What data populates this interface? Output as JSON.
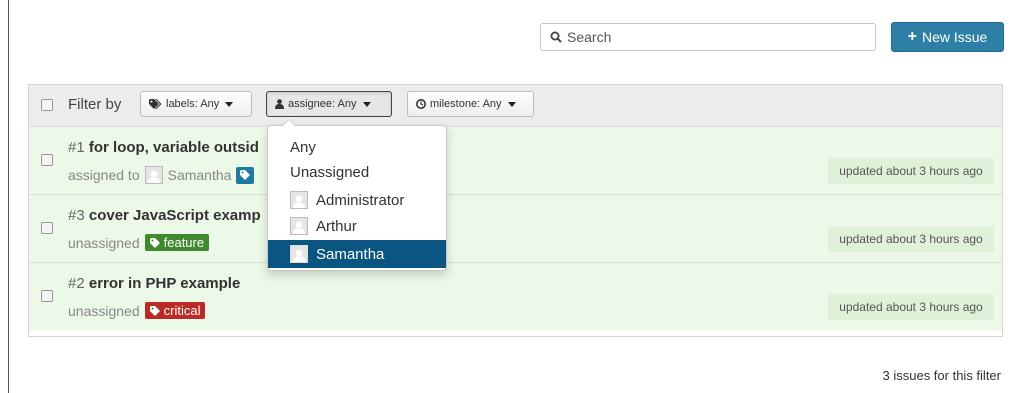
{
  "header": {
    "search_placeholder": "Search",
    "new_issue_label": "New Issue"
  },
  "filter": {
    "label": "Filter by",
    "labels_button": "labels: Any",
    "assignee_button": "assignee: Any",
    "milestone_button": "milestone: Any"
  },
  "issues": [
    {
      "number": "#1",
      "title": "for loop, variable outsid",
      "assignment": "assigned to",
      "assignee": "Samantha",
      "label": "",
      "label_color": "#1f7aa0",
      "updated": "updated about 3 hours ago"
    },
    {
      "number": "#3",
      "title": "cover JavaScript examp",
      "assignment": "unassigned",
      "label": "feature",
      "label_color": "#3f8a2e",
      "updated": "updated about 3 hours ago"
    },
    {
      "number": "#2",
      "title": "error in PHP example",
      "assignment": "unassigned",
      "label": "critical",
      "label_color": "#b92b27",
      "updated": "updated about 3 hours ago"
    }
  ],
  "assignee_dropdown": {
    "options": [
      "Any",
      "Unassigned",
      "Administrator",
      "Arthur",
      "Samantha"
    ],
    "selected": "Samantha"
  },
  "footer": {
    "count_text": "3 issues for this filter"
  },
  "colors": {
    "primary_button": "#2d7fa6",
    "selected_item": "#0a5581",
    "issue_background": "#ecf9e8"
  }
}
